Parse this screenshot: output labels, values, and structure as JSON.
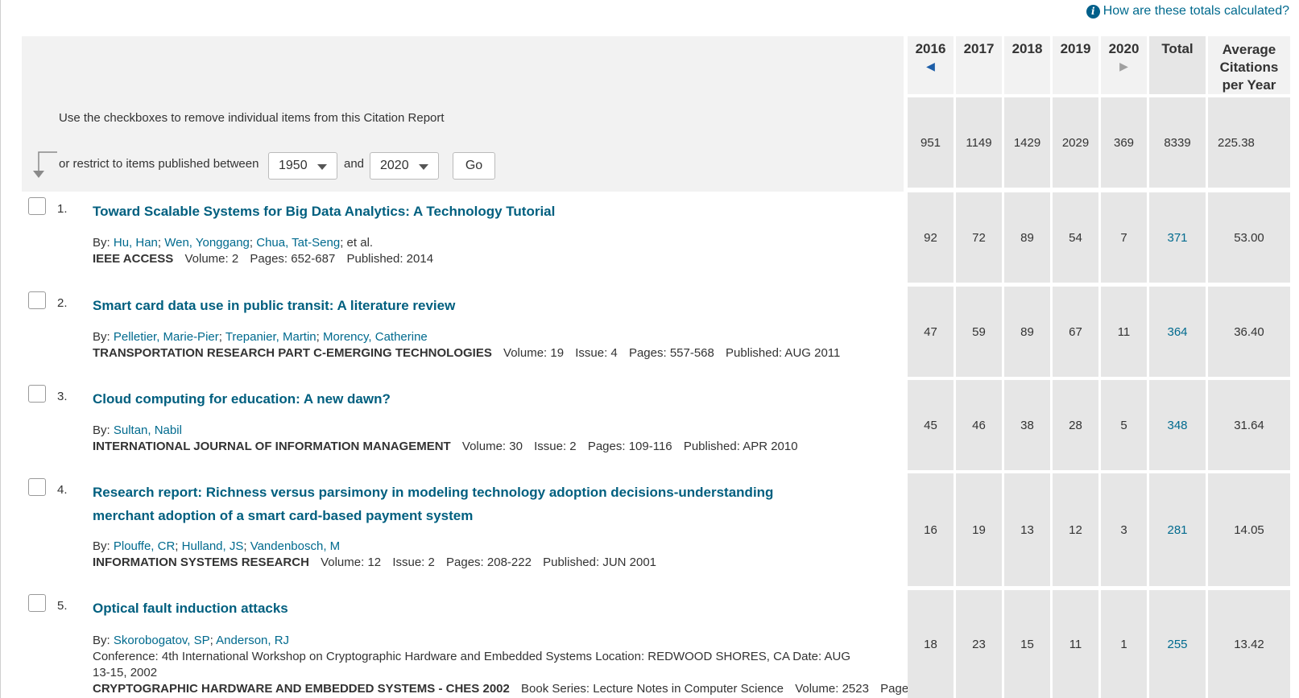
{
  "help_link": "How are these totals calculated?",
  "instructions": "Use the checkboxes to remove individual items from this Citation Report",
  "restrict": {
    "label": "or restrict to items published between",
    "from": "1950",
    "and_label": "and",
    "to": "2020",
    "go_label": "Go"
  },
  "headers": {
    "years": [
      "2016",
      "2017",
      "2018",
      "2019",
      "2020"
    ],
    "total": "Total",
    "average": [
      "Average",
      "Citations",
      "per Year"
    ],
    "prev_arrow": "◀",
    "next_arrow": "▶"
  },
  "totals": [
    "951",
    "1149",
    "1429",
    "2029",
    "369",
    "8339",
    "225.38"
  ],
  "items": [
    {
      "num": "1.",
      "title": "Toward Scalable Systems for Big Data Analytics: A Technology Tutorial",
      "by": "By:",
      "authors": [
        "Hu, Han",
        "Wen, Yonggang",
        "Chua, Tat-Seng"
      ],
      "et_al": "; et al.",
      "journal": "IEEE ACCESS",
      "details": [
        "Volume: 2",
        "Pages: 652-687",
        "Published: 2014"
      ],
      "counts": [
        "92",
        "72",
        "89",
        "54",
        "7"
      ],
      "total": "371",
      "avg": "53.00"
    },
    {
      "num": "2.",
      "title": "Smart card data use in public transit: A literature review",
      "by": "By:",
      "authors": [
        "Pelletier, Marie-Pier",
        "Trepanier, Martin",
        "Morency, Catherine"
      ],
      "journal": "TRANSPORTATION RESEARCH PART C-EMERGING TECHNOLOGIES",
      "details": [
        "Volume: 19",
        "Issue: 4",
        "Pages: 557-568",
        "Published: AUG 2011"
      ],
      "counts": [
        "47",
        "59",
        "89",
        "67",
        "11"
      ],
      "total": "364",
      "avg": "36.40"
    },
    {
      "num": "3.",
      "title": "Cloud computing for education: A new dawn?",
      "by": "By:",
      "authors": [
        "Sultan, Nabil"
      ],
      "journal": "INTERNATIONAL JOURNAL OF INFORMATION MANAGEMENT",
      "details": [
        "Volume: 30",
        "Issue: 2",
        "Pages: 109-116",
        "Published: APR 2010"
      ],
      "counts": [
        "45",
        "46",
        "38",
        "28",
        "5"
      ],
      "total": "348",
      "avg": "31.64"
    },
    {
      "num": "4.",
      "title": "Research report: Richness versus parsimony in modeling technology adoption decisions-understanding merchant adoption of a smart card-based payment system",
      "by": "By:",
      "authors": [
        "Plouffe, CR",
        "Hulland, JS",
        "Vandenbosch, M"
      ],
      "journal": "INFORMATION SYSTEMS RESEARCH",
      "details": [
        "Volume: 12",
        "Issue: 2",
        "Pages: 208-222",
        "Published: JUN 2001"
      ],
      "counts": [
        "16",
        "19",
        "13",
        "12",
        "3"
      ],
      "total": "281",
      "avg": "14.05"
    },
    {
      "num": "5.",
      "title": "Optical fault induction attacks",
      "by": "By:",
      "authors": [
        "Skorobogatov, SP",
        "Anderson, RJ"
      ],
      "conference": "Conference: 4th International Workshop on Cryptographic Hardware and Embedded Systems Location: REDWOOD SHORES, CA Date: AUG 13-15, 2002",
      "journal": "CRYPTOGRAPHIC HARDWARE AND EMBEDDED SYSTEMS - CHES 2002",
      "details": [
        "Book Series: Lecture Notes in Computer Science",
        "Volume: 2523",
        "Pages:"
      ],
      "counts": [
        "18",
        "23",
        "15",
        "11",
        "1"
      ],
      "total": "255",
      "avg": "13.42"
    }
  ]
}
